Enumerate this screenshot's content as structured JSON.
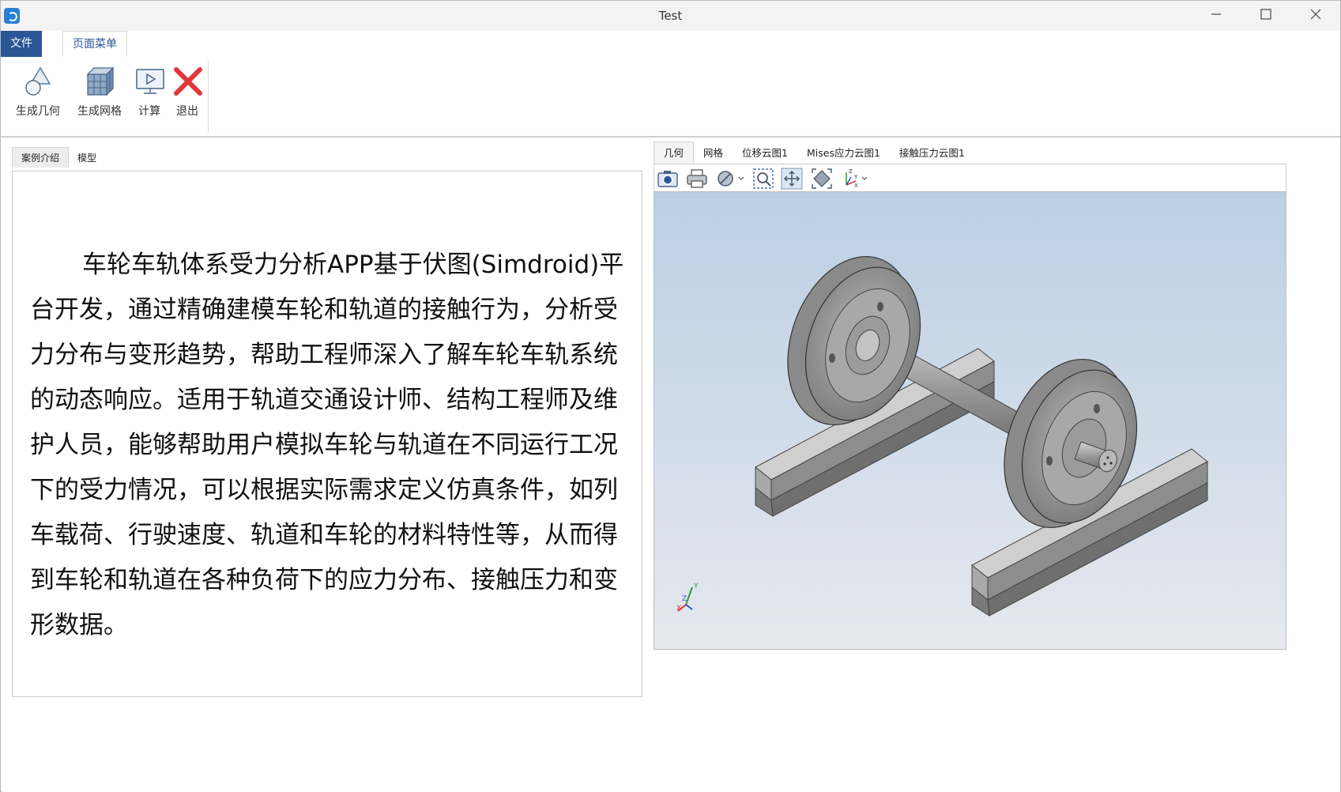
{
  "window": {
    "title": "Test",
    "minimize_icon": "minimize-icon",
    "maximize_icon": "maximize-icon",
    "close_icon": "close-icon"
  },
  "ribbon": {
    "tabs": [
      {
        "label": "文件"
      },
      {
        "label": "页面菜单"
      }
    ],
    "buttons": [
      {
        "label": "生成几何",
        "icon": "geometry-icon"
      },
      {
        "label": "生成网格",
        "icon": "mesh-icon"
      },
      {
        "label": "计算",
        "icon": "compute-icon"
      },
      {
        "label": "退出",
        "icon": "exit-icon"
      }
    ]
  },
  "left_panel": {
    "tabs": [
      {
        "label": "案例介绍"
      },
      {
        "label": "模型"
      }
    ],
    "intro_text": "车轮车轨体系受力分析APP基于伏图(Simdroid)平台开发，通过精确建模车轮和轨道的接触行为，分析受力分布与变形趋势，帮助工程师深入了解车轮车轨系统的动态响应。适用于轨道交通设计师、结构工程师及维护人员，能够帮助用户模拟车轮与轨道在不同运行工况下的受力情况，可以根据实际需求定义仿真条件，如列车载荷、行驶速度、轨道和车轮的材料特性等，从而得到车轮和轨道在各种负荷下的应力分布、接触压力和变形数据。"
  },
  "viewer": {
    "tabs": [
      {
        "label": "几何"
      },
      {
        "label": "网格"
      },
      {
        "label": "位移云图1"
      },
      {
        "label": "Mises应力云图1"
      },
      {
        "label": "接触压力云图1"
      }
    ],
    "toolbar": [
      "camera-icon",
      "print-icon",
      "display-mode-icon",
      "zoom-box-icon",
      "pan-icon",
      "fit-view-icon",
      "axis-view-icon"
    ],
    "axis_labels": {
      "x": "X",
      "y": "Y",
      "z": "Z"
    }
  },
  "colors": {
    "accent": "#2b5797",
    "exit_red": "#e0353a",
    "viewport_top": "#bccfe4",
    "viewport_bottom": "#e5e8ee"
  }
}
